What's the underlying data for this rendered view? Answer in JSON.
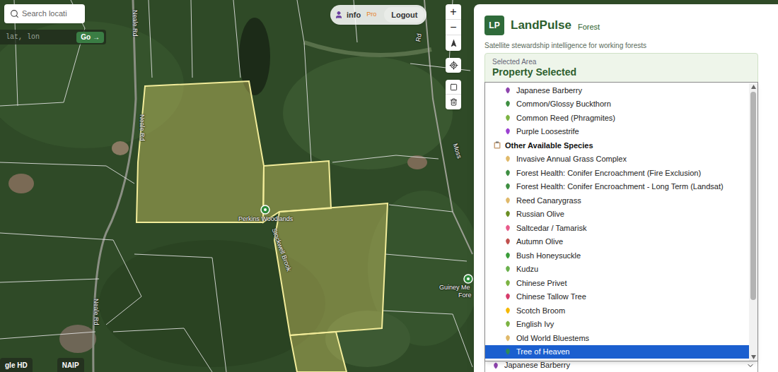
{
  "search": {
    "placeholder": "Search locati"
  },
  "coordinates": {
    "placeholder": "lat, lon",
    "button": "Go →"
  },
  "account": {
    "user": "info",
    "plan": "Pro",
    "logout": "Logout"
  },
  "map_controls": [
    "+",
    "−"
  ],
  "map_labels": [
    "Neale Rd",
    "Neale Rd",
    "Neale Rd",
    "Stockwell Brook",
    "Perkins Woodlands",
    "Guiney Me",
    "Fore",
    "Moss",
    "Rd"
  ],
  "basemap_buttons": [
    "gle HD",
    "NAIP"
  ],
  "app": {
    "logo": "LP",
    "name": "LandPulse",
    "edition": "Forest",
    "tagline": "Satellite stewardship intelligence for working forests"
  },
  "selected_area": {
    "label": "Selected Area",
    "title": "Property Selected"
  },
  "species_list": {
    "scroll_thumb": {
      "level": 0.8
    },
    "items": [
      {
        "kind": "option",
        "label": "Japanese Barberry",
        "selected": false,
        "color": "#8e44ad"
      },
      {
        "kind": "option",
        "label": "Common/Glossy Buckthorn",
        "selected": false,
        "color": "#3e8e41"
      },
      {
        "kind": "option",
        "label": "Common Reed (Phragmites)",
        "selected": false,
        "color": "#7cb342"
      },
      {
        "kind": "option",
        "label": "Purple Loosestrife",
        "selected": false,
        "color": "#9b3fd1"
      },
      {
        "kind": "group",
        "label": "Other Available Species",
        "selected": false,
        "color": "#c8a27a"
      },
      {
        "kind": "option",
        "label": "Invasive Annual Grass Complex",
        "selected": false,
        "color": "#e0b96a"
      },
      {
        "kind": "option",
        "label": "Forest Health: Conifer Encroachment (Fire Exclusion)",
        "selected": false,
        "color": "#3e8e41"
      },
      {
        "kind": "option",
        "label": "Forest Health: Conifer Encroachment - Long Term (Landsat)",
        "selected": false,
        "color": "#3e8e41"
      },
      {
        "kind": "option",
        "label": "Reed Canarygrass",
        "selected": false,
        "color": "#e0b96a"
      },
      {
        "kind": "option",
        "label": "Russian Olive",
        "selected": false,
        "color": "#6b8e23"
      },
      {
        "kind": "option",
        "label": "Saltcedar / Tamarisk",
        "selected": false,
        "color": "#e85a8a"
      },
      {
        "kind": "option",
        "label": "Autumn Olive",
        "selected": false,
        "color": "#c0504d"
      },
      {
        "kind": "option",
        "label": "Bush Honeysuckle",
        "selected": false,
        "color": "#3a9d3a"
      },
      {
        "kind": "option",
        "label": "Kudzu",
        "selected": false,
        "color": "#6ab04c"
      },
      {
        "kind": "option",
        "label": "Chinese Privet",
        "selected": false,
        "color": "#7cb342"
      },
      {
        "kind": "option",
        "label": "Chinese Tallow Tree",
        "selected": false,
        "color": "#d63b6a"
      },
      {
        "kind": "option",
        "label": "Scotch Broom",
        "selected": false,
        "color": "#f5b800"
      },
      {
        "kind": "option",
        "label": "English Ivy",
        "selected": false,
        "color": "#7cb342"
      },
      {
        "kind": "option",
        "label": "Old World Bluestems",
        "selected": false,
        "color": "#e0b96a"
      },
      {
        "kind": "option",
        "label": "Tree of Heaven",
        "selected": true,
        "color": "#2e8b57"
      }
    ]
  },
  "species_select": {
    "value": "Japanese Barberry",
    "color": "#8e44ad"
  }
}
